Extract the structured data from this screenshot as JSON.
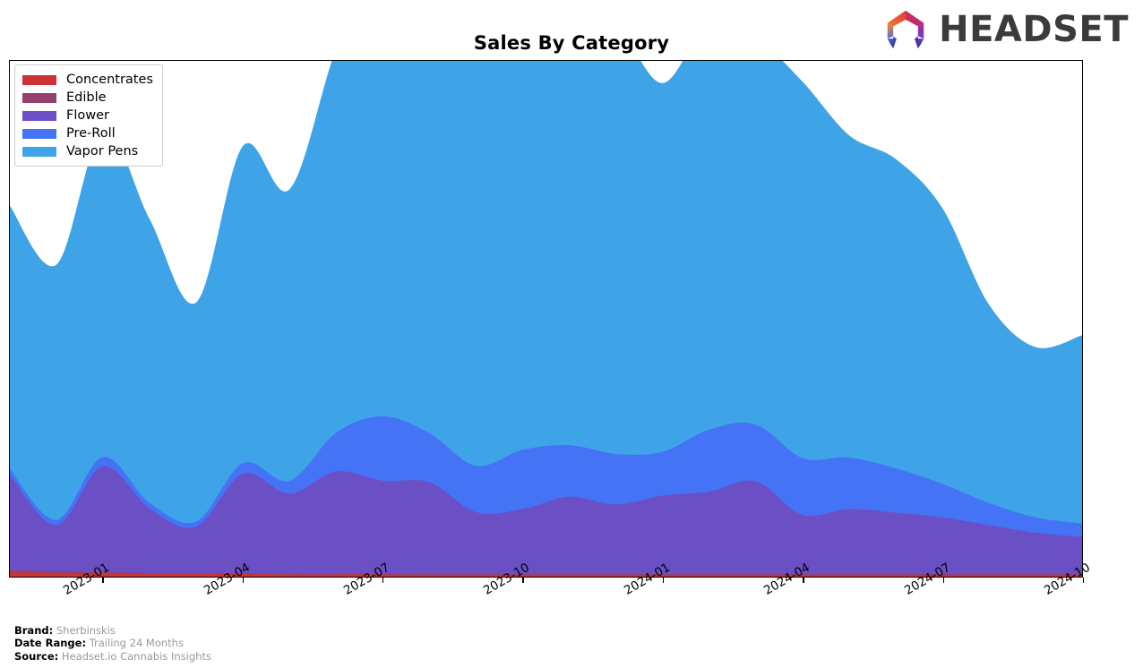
{
  "header": {
    "title": "Sales By Category",
    "logo_word": "HEADSET",
    "logo_icon": "headset-arch-logo"
  },
  "legend": {
    "position": "upper-left",
    "items": [
      {
        "label": "Concentrates",
        "color": "#cc3333"
      },
      {
        "label": "Edible",
        "color": "#94406f"
      },
      {
        "label": "Flower",
        "color": "#6b4fc4"
      },
      {
        "label": "Pre-Roll",
        "color": "#4573f5"
      },
      {
        "label": "Vapor Pens",
        "color": "#3fa3e8"
      }
    ]
  },
  "footer": {
    "rows": [
      {
        "key": "Brand:",
        "value": "Sherbinskis"
      },
      {
        "key": "Date Range:",
        "value": "Trailing 24 Months"
      },
      {
        "key": "Source:",
        "value": "Headset.io Cannabis Insights"
      }
    ]
  },
  "chart_data": {
    "type": "area",
    "stacked": true,
    "title": "Sales By Category",
    "xlabel": "",
    "ylabel": "",
    "grid": false,
    "legend_position": "upper left",
    "axis_tick_labels": [
      "2023-01",
      "2023-04",
      "2023-07",
      "2023-10",
      "2024-01",
      "2024-04",
      "2024-07",
      "2024-10"
    ],
    "x": [
      "2022-11",
      "2022-12",
      "2023-01",
      "2023-02",
      "2023-03",
      "2023-04",
      "2023-05",
      "2023-06",
      "2023-07",
      "2023-08",
      "2023-09",
      "2023-10",
      "2023-11",
      "2023-12",
      "2024-01",
      "2024-02",
      "2024-03",
      "2024-04",
      "2024-05",
      "2024-06",
      "2024-07",
      "2024-08",
      "2024-09",
      "2024-10"
    ],
    "ylim": [
      0,
      100
    ],
    "series": [
      {
        "name": "Concentrates",
        "color": "#cc3333",
        "values": [
          0.9,
          0.7,
          0.6,
          0.5,
          0.5,
          0.5,
          0.4,
          0.4,
          0.4,
          0.3,
          0.3,
          0.3,
          0.3,
          0.3,
          0.3,
          0.3,
          0.3,
          0.3,
          0.3,
          0.3,
          0.3,
          0.3,
          0.3,
          0.3
        ]
      },
      {
        "name": "Edible",
        "color": "#94406f",
        "values": [
          0.3,
          0.3,
          0.3,
          0.2,
          0.2,
          0.2,
          0.2,
          0.2,
          0.2,
          0.2,
          0.2,
          0.2,
          0.2,
          0.2,
          0.2,
          0.2,
          0.2,
          0.2,
          0.2,
          0.2,
          0.2,
          0.2,
          0.2,
          0.2
        ]
      },
      {
        "name": "Flower",
        "color": "#6b4fc4",
        "values": [
          18.5,
          9.0,
          20.5,
          12.5,
          9.0,
          19.3,
          15.5,
          19.8,
          18.0,
          17.8,
          12.0,
          12.6,
          15.0,
          13.5,
          15.2,
          16.0,
          18.0,
          11.5,
          12.6,
          11.9,
          11.0,
          9.5,
          8.0,
          7.2
        ]
      },
      {
        "name": "Pre-Roll",
        "color": "#4573f5",
        "values": [
          1.2,
          1.0,
          1.8,
          1.1,
          1.0,
          2.0,
          2.5,
          7.5,
          12.5,
          9.5,
          9.0,
          11.5,
          10.0,
          9.8,
          8.5,
          12.0,
          11.0,
          11.0,
          10.0,
          8.6,
          6.5,
          4.3,
          3.0,
          2.6
        ]
      },
      {
        "name": "Vapor Pens",
        "color": "#3fa3e8",
        "values": [
          51.0,
          49.5,
          63.2,
          55.0,
          42.5,
          61.5,
          56.5,
          74.5,
          91.0,
          78.5,
          80.5,
          80.0,
          81.0,
          83.0,
          71.5,
          79.0,
          75.0,
          73.0,
          62.5,
          60.0,
          53.5,
          38.5,
          33.0,
          36.5
        ]
      }
    ]
  }
}
